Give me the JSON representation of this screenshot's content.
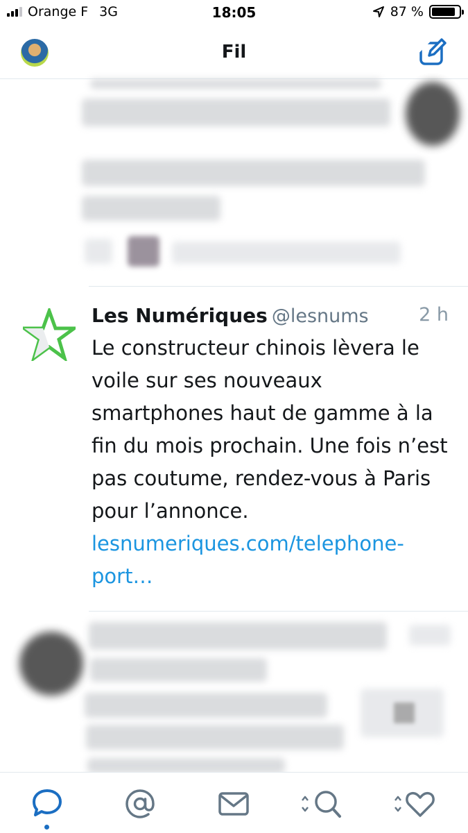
{
  "status_bar": {
    "carrier": "Orange F",
    "network": "3G",
    "time": "18:05",
    "battery_text": "87 %",
    "battery_level": 0.87
  },
  "nav": {
    "title": "Fil",
    "left_icon": "profile-avatar",
    "right_icon": "compose-icon"
  },
  "tweet": {
    "display_name": "Les Numériques",
    "handle": "@lesnums",
    "time": "2 h",
    "text": "Le constructeur chinois lèvera le voile sur ses nouveaux smartphones haut de gamme à la fin du mois prochain. Une fois n’est pas coutume, rendez-vous à Paris pour l’annonce.",
    "link": "lesnumeriques.com/telephone-port…",
    "avatar_icon": "star-icon"
  },
  "tab_bar": {
    "active_tab": 0,
    "tabs": [
      {
        "icon": "chat-bubble-icon"
      },
      {
        "icon": "at-icon"
      },
      {
        "icon": "envelope-icon"
      },
      {
        "icon": "search-icon"
      },
      {
        "icon": "heart-icon"
      }
    ]
  },
  "colors": {
    "accent": "#1b6ec2",
    "link": "#1b95e0",
    "text": "#14171a",
    "secondary": "#657786",
    "divider": "#e1e8ed",
    "star_green": "#4cc24a"
  }
}
